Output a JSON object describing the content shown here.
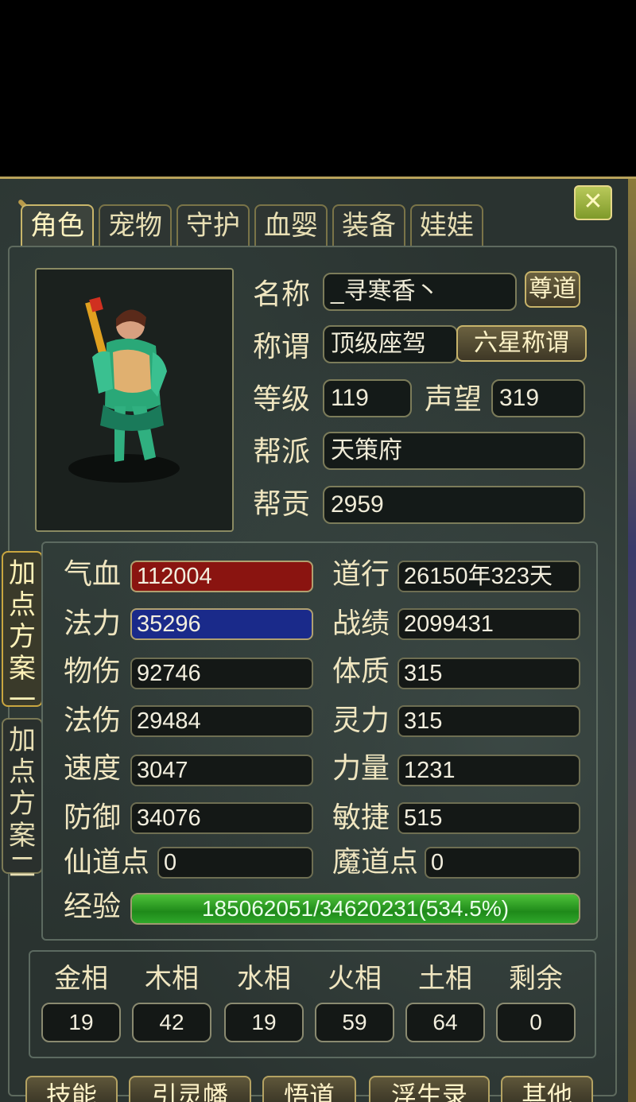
{
  "tabs": [
    {
      "label": "角色",
      "active": true
    },
    {
      "label": "宠物",
      "active": false
    },
    {
      "label": "守护",
      "active": false
    },
    {
      "label": "血婴",
      "active": false
    },
    {
      "label": "装备",
      "active": false
    },
    {
      "label": "娃娃",
      "active": false
    }
  ],
  "close_icon": "close-icon",
  "profile": {
    "name_label": "名称",
    "name_value": "_寻寒香丶",
    "dao_button": "尊道",
    "title_label": "称谓",
    "title_value": "顶级座驾",
    "six_star_button": "六星称谓",
    "level_label": "等级",
    "level_value": "119",
    "prestige_label": "声望",
    "prestige_value": "319",
    "faction_label": "帮派",
    "faction_value": "天策府",
    "contribution_label": "帮贡",
    "contribution_value": "2959"
  },
  "side_tabs": [
    {
      "label": "加点方案一",
      "active": true
    },
    {
      "label": "加点方案二",
      "active": false
    }
  ],
  "stats_left": [
    {
      "label": "气血",
      "value": "112004",
      "style": "red"
    },
    {
      "label": "法力",
      "value": "35296",
      "style": "blue"
    },
    {
      "label": "物伤",
      "value": "92746",
      "style": "plain"
    },
    {
      "label": "法伤",
      "value": "29484",
      "style": "plain"
    },
    {
      "label": "速度",
      "value": "3047",
      "style": "plain"
    },
    {
      "label": "防御",
      "value": "34076",
      "style": "plain"
    },
    {
      "label": "仙道点",
      "value": "0",
      "style": "plain"
    }
  ],
  "stats_right": [
    {
      "label": "道行",
      "value": "26150年323天"
    },
    {
      "label": "战绩",
      "value": "2099431"
    },
    {
      "label": "体质",
      "value": "315"
    },
    {
      "label": "灵力",
      "value": "315"
    },
    {
      "label": "力量",
      "value": "1231"
    },
    {
      "label": "敏捷",
      "value": "515"
    },
    {
      "label": "魔道点",
      "value": "0"
    }
  ],
  "exp": {
    "label": "经验",
    "text": "185062051/34620231(534.5%)",
    "fill_fraction": 1.0
  },
  "elements": [
    {
      "label": "金相",
      "value": "19"
    },
    {
      "label": "木相",
      "value": "42"
    },
    {
      "label": "水相",
      "value": "19"
    },
    {
      "label": "火相",
      "value": "59"
    },
    {
      "label": "土相",
      "value": "64"
    },
    {
      "label": "剩余",
      "value": "0"
    }
  ],
  "bottom_buttons": [
    "技能",
    "引灵幡",
    "悟道",
    "浮生录",
    "其他"
  ]
}
